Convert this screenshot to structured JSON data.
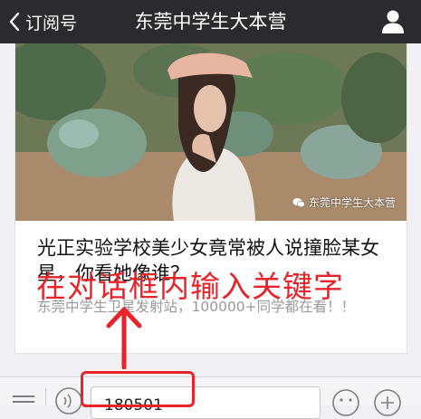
{
  "nav": {
    "back_label": "订阅号",
    "title": "东莞中学生大本营"
  },
  "article": {
    "title": "光正实验学校美少女竟常被人说撞脸某女星，你看她像谁？",
    "summary": "东莞中学生卫星发射站，100000+同学都在看！！",
    "watermark": "东莞中学生大本营"
  },
  "annotation": {
    "text": "在对话框内输入关键字",
    "color": "#e8232a"
  },
  "input_bar": {
    "value": "180501"
  },
  "colors": {
    "navbar": "#2b2b2f",
    "annotation": "#e8232a",
    "summary_text": "#9a9a9a"
  }
}
